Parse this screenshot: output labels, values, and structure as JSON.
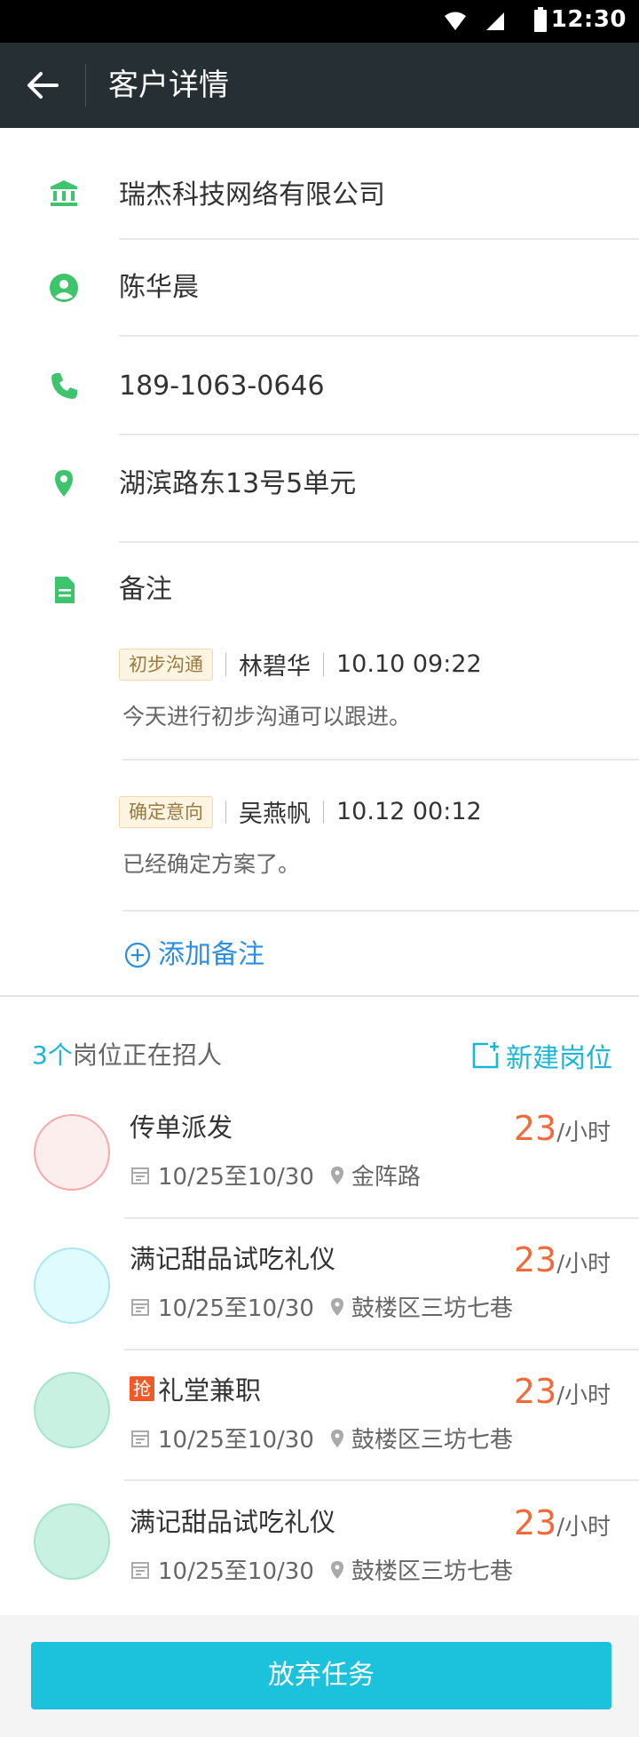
{
  "status_bar": {
    "time": "12:30"
  },
  "app_bar": {
    "title": "客户详情"
  },
  "customer": {
    "company": "瑞杰科技网络有限公司",
    "contact": "陈华晨",
    "phone": "189-1063-0646",
    "address": "湖滨路东13号5单元"
  },
  "notes": {
    "label": "备注",
    "items": [
      {
        "tag": "初步沟通",
        "author": "林碧华",
        "time": "10.10 09:22",
        "text": "今天进行初步沟通可以跟进。"
      },
      {
        "tag": "确定意向",
        "author": "吴燕帆",
        "time": "10.12 00:12",
        "text": "已经确定方案了。"
      }
    ],
    "add_label": "添加备注"
  },
  "jobs": {
    "count": "3个",
    "count_rest": "岗位正在招人",
    "new_label": "新建岗位",
    "items": [
      {
        "name": "传单派发",
        "date": "10/25至10/30",
        "location": "金阵路",
        "salary": "23",
        "unit": "/小时",
        "badge": "",
        "avatar_color": "#fdeeee",
        "avatar_border": "#f3a9a9"
      },
      {
        "name": "满记甜品试吃礼仪",
        "date": "10/25至10/30",
        "location": "鼓楼区三坊七巷",
        "salary": "23",
        "unit": "/小时",
        "badge": "",
        "avatar_color": "#dffbfd",
        "avatar_border": "#a9e6ee"
      },
      {
        "name": "礼堂兼职",
        "date": "10/25至10/30",
        "location": "鼓楼区三坊七巷",
        "salary": "23",
        "unit": "/小时",
        "badge": "抢",
        "avatar_color": "#c9f1e2",
        "avatar_border": "#a6e3cc"
      },
      {
        "name": "满记甜品试吃礼仪",
        "date": "10/25至10/30",
        "location": "鼓楼区三坊七巷",
        "salary": "23",
        "unit": "/小时",
        "badge": "",
        "avatar_color": "#c9f1e2",
        "avatar_border": "#a6e3cc"
      }
    ]
  },
  "bottom": {
    "giveup_label": "放弃任务"
  },
  "colors": {
    "accent": "#1cc2dc",
    "icon_green": "#3ec46d",
    "salary": "#f26a3a",
    "link_blue": "#2c8fde"
  }
}
